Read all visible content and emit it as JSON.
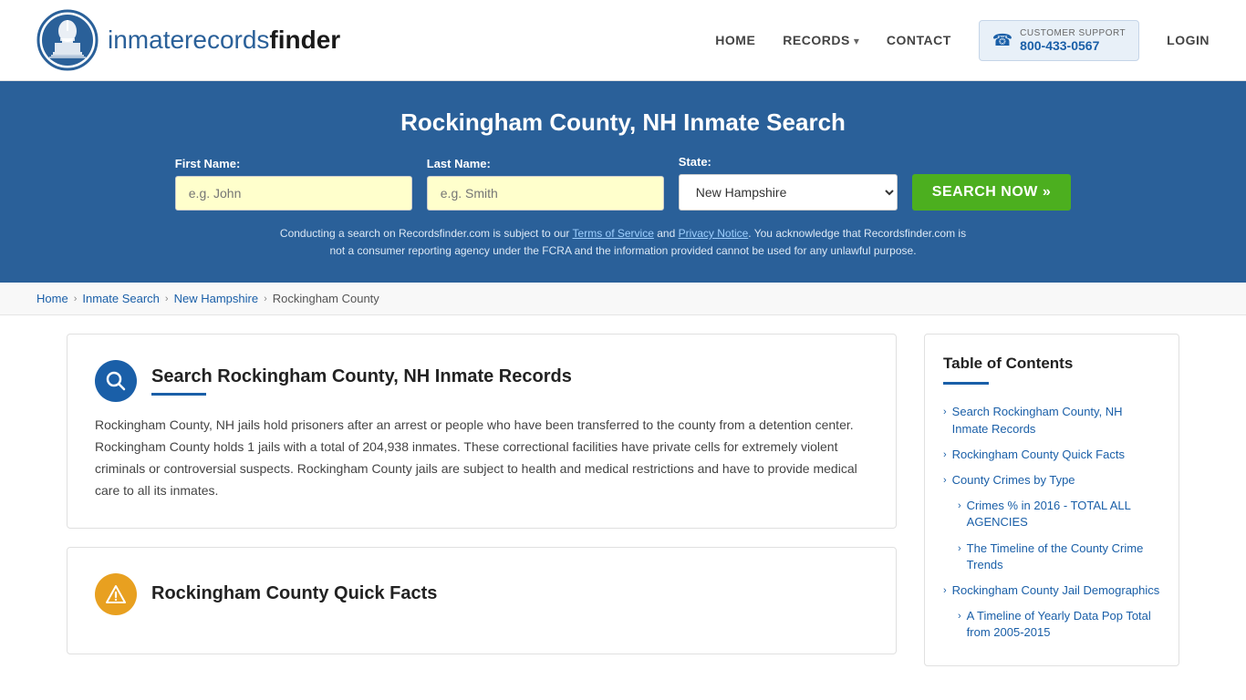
{
  "header": {
    "logo_text_regular": "inmaterecords",
    "logo_text_bold": "finder",
    "nav": {
      "home": "HOME",
      "records": "RECORDS",
      "contact": "CONTACT",
      "support_label": "CUSTOMER SUPPORT",
      "support_number": "800-433-0567",
      "login": "LOGIN"
    }
  },
  "hero": {
    "title": "Rockingham County, NH Inmate Search",
    "first_name_label": "First Name:",
    "first_name_placeholder": "e.g. John",
    "last_name_label": "Last Name:",
    "last_name_placeholder": "e.g. Smith",
    "state_label": "State:",
    "state_value": "New Hampshire",
    "search_btn": "SEARCH NOW »",
    "disclaimer": "Conducting a search on Recordsfinder.com is subject to our Terms of Service and Privacy Notice. You acknowledge that Recordsfinder.com is not a consumer reporting agency under the FCRA and the information provided cannot be used for any unlawful purpose.",
    "terms_link": "Terms of Service",
    "privacy_link": "Privacy Notice"
  },
  "breadcrumb": {
    "home": "Home",
    "inmate_search": "Inmate Search",
    "new_hampshire": "New Hampshire",
    "rockingham_county": "Rockingham County"
  },
  "main_section": {
    "title": "Search Rockingham County, NH Inmate Records",
    "body": "Rockingham County, NH jails hold prisoners after an arrest or people who have been transferred to the county from a detention center. Rockingham County holds 1 jails with a total of 204,938 inmates. These correctional facilities have private cells for extremely violent criminals or controversial suspects. Rockingham County jails are subject to health and medical restrictions and have to provide medical care to all its inmates."
  },
  "quick_facts_section": {
    "title": "Rockingham County Quick Facts"
  },
  "toc": {
    "title": "Table of Contents",
    "items": [
      {
        "label": "Search Rockingham County, NH Inmate Records",
        "indent": false
      },
      {
        "label": "Rockingham County Quick Facts",
        "indent": false
      },
      {
        "label": "County Crimes by Type",
        "indent": false
      },
      {
        "label": "Crimes % in 2016 - TOTAL ALL AGENCIES",
        "indent": true
      },
      {
        "label": "The Timeline of the County Crime Trends",
        "indent": true
      },
      {
        "label": "Rockingham County Jail Demographics",
        "indent": false
      },
      {
        "label": "A Timeline of Yearly Data Pop Total from 2005-2015",
        "indent": true
      }
    ]
  }
}
